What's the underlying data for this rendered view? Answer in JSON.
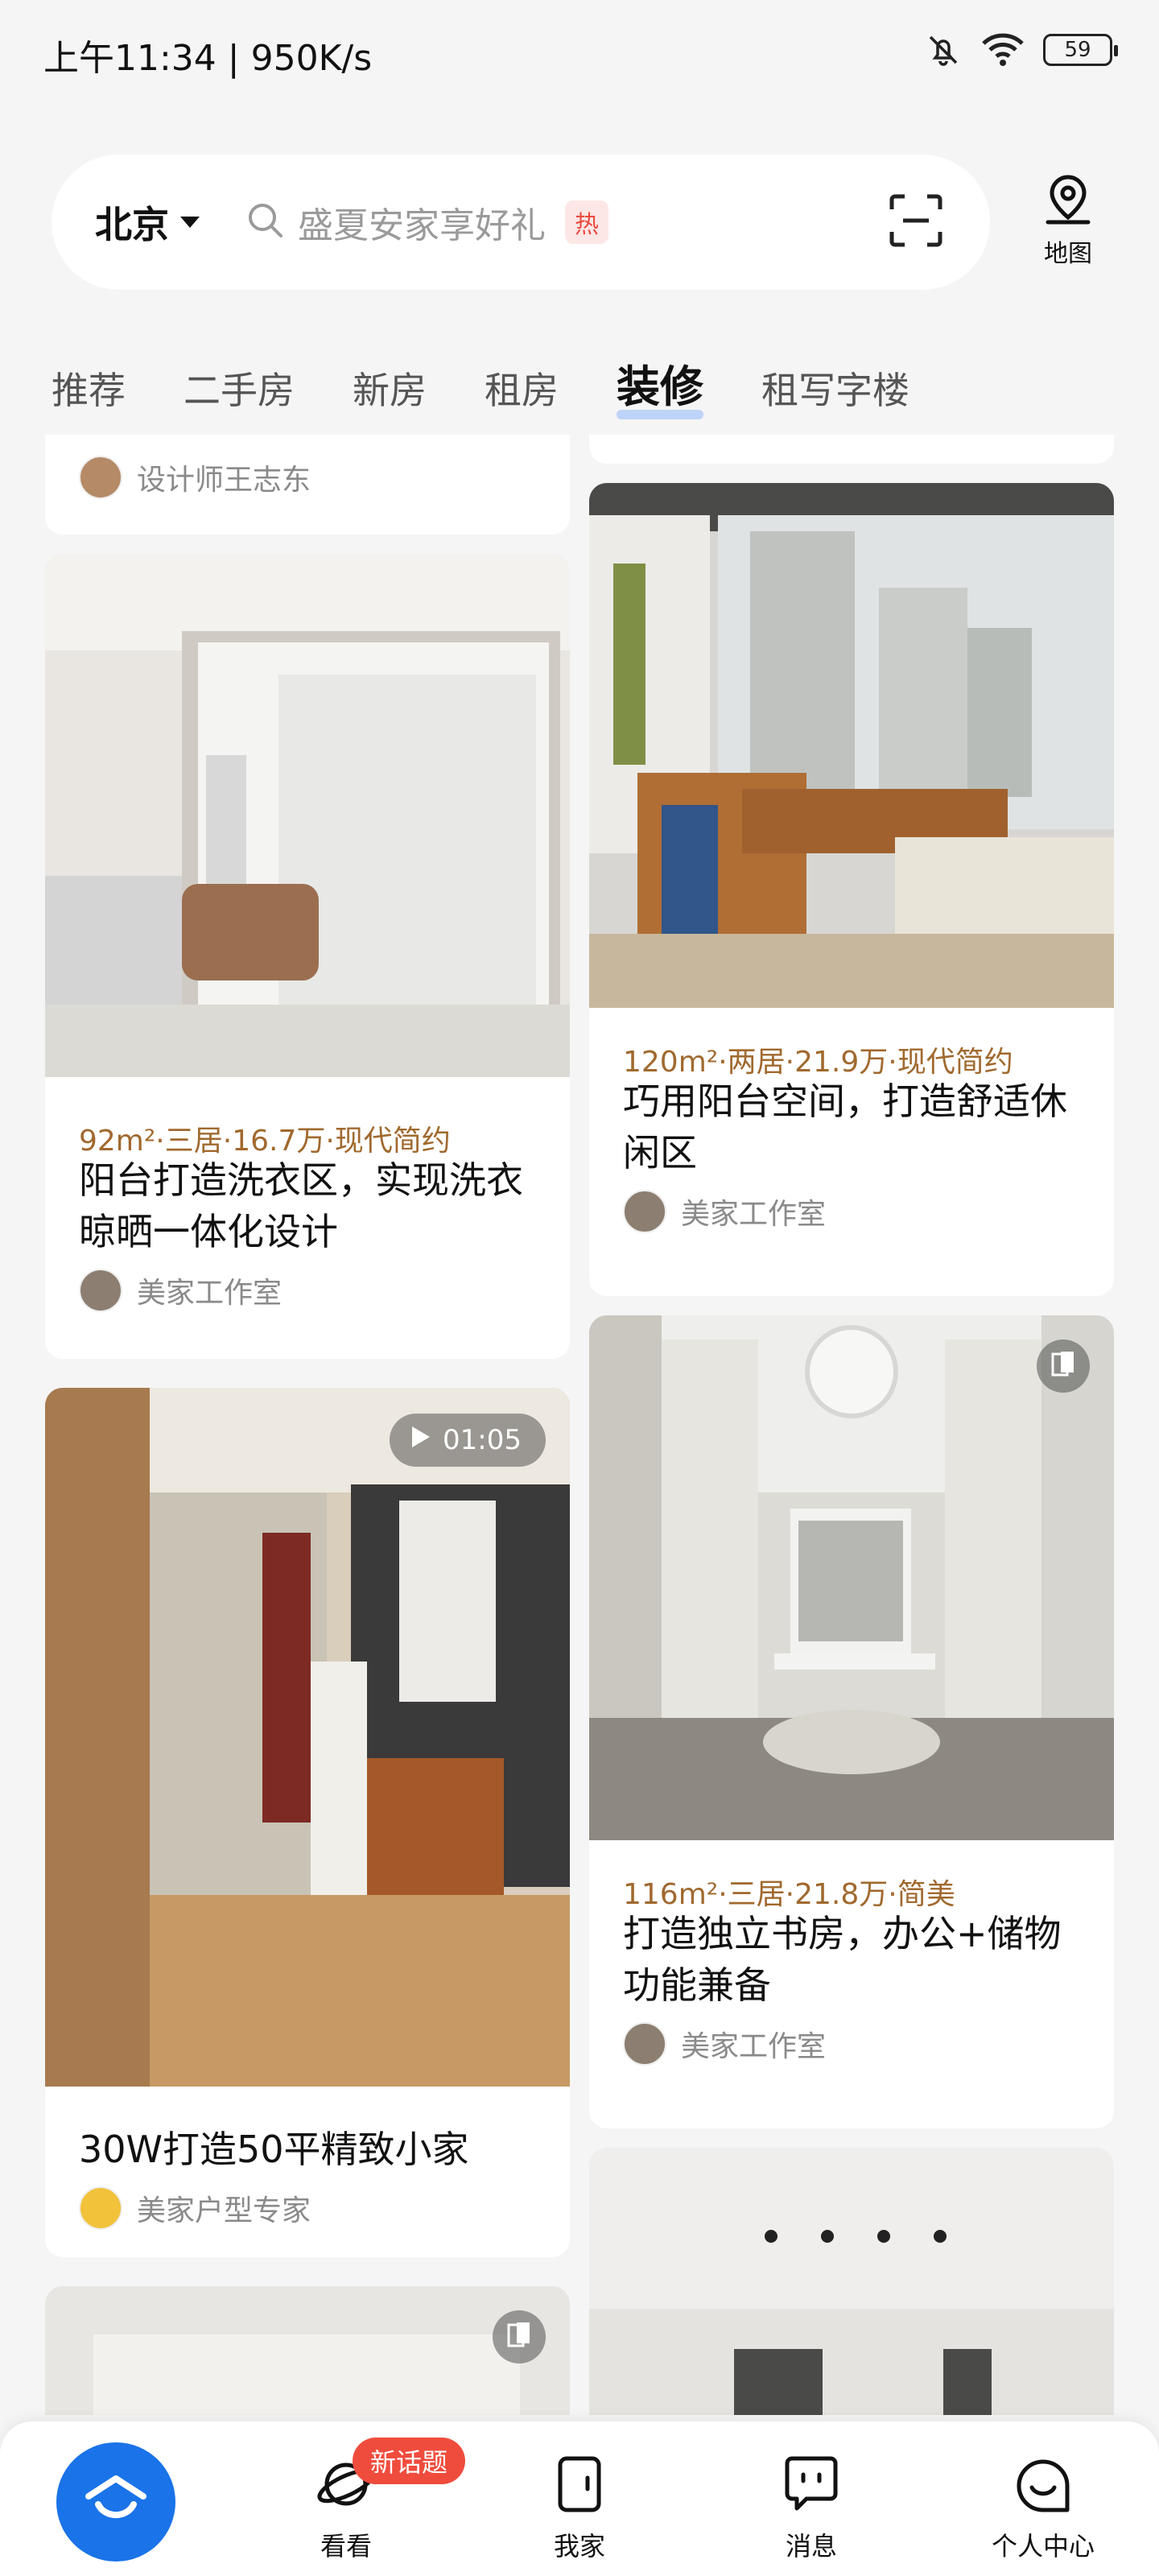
{
  "status_bar": {
    "time": "上午11:34 | 950K/s",
    "battery": "59"
  },
  "header": {
    "city": "北京",
    "search_placeholder": "盛夏安家享好礼",
    "hot_badge": "热",
    "map_label": "地图"
  },
  "tabs": [
    {
      "label": "推荐",
      "active": false
    },
    {
      "label": "二手房",
      "active": false
    },
    {
      "label": "新房",
      "active": false
    },
    {
      "label": "租房",
      "active": false
    },
    {
      "label": "装修",
      "active": true
    },
    {
      "label": "租写字楼",
      "active": false
    }
  ],
  "feed": {
    "left": [
      {
        "author": "设计师王志东"
      },
      {
        "meta": "92m²·三居·16.7万·现代简约",
        "title": "阳台打造洗衣区，实现洗衣晾晒一体化设计",
        "author": "美家工作室"
      },
      {
        "video_duration": "01:05",
        "title": "30W打造50平精致小家",
        "author": "美家户型专家"
      }
    ],
    "right": [
      {
        "meta": "120m²·两居·21.9万·现代简约",
        "title": "巧用阳台空间，打造舒适休闲区",
        "author": "美家工作室"
      },
      {
        "meta": "116m²·三居·21.8万·简美",
        "title": "打造独立书房，办公+储物功能兼备",
        "author": "美家工作室"
      }
    ]
  },
  "bottom_nav": {
    "new_topic_badge": "新话题",
    "items": [
      {
        "label": "看看",
        "icon": "planet-icon"
      },
      {
        "label": "我家",
        "icon": "door-icon"
      },
      {
        "label": "消息",
        "icon": "message-icon"
      },
      {
        "label": "个人中心",
        "icon": "smile-icon"
      }
    ]
  },
  "colors": {
    "accent": "#1a73e8",
    "meta_text": "#a0692e",
    "hot": "#ea4b40",
    "badge_red": "#ef4c3d"
  }
}
